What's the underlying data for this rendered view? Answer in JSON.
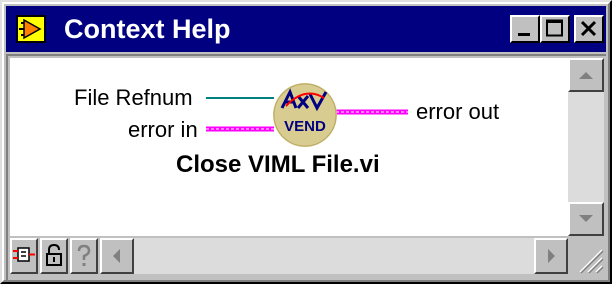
{
  "window": {
    "title": "Context Help",
    "title_icon": "context-help-window-icon",
    "titlebar_color": "#000080",
    "buttons": {
      "minimize": "minimize-icon",
      "maximize": "maximize-icon",
      "close": "close-icon"
    }
  },
  "diagram": {
    "vi_icon_text": "VEND",
    "vi_name": "Close VIML File.vi",
    "terminals": {
      "file_refnum": "File Refnum",
      "error_in": "error in",
      "error_out": "error out"
    },
    "wire_colors": {
      "refnum": "#008080",
      "error": "#ff00ff"
    }
  },
  "toolbar": {
    "buttons": [
      {
        "icon": "show-detailed-diagram-icon"
      },
      {
        "icon": "lock-icon"
      },
      {
        "icon": "help-question-icon"
      }
    ]
  },
  "scrollbars": {
    "vertical": [
      "scroll-up-arrow-icon",
      "scroll-down-arrow-icon"
    ],
    "horizontal": [
      "scroll-left-arrow-icon",
      "scroll-right-arrow-icon"
    ]
  }
}
